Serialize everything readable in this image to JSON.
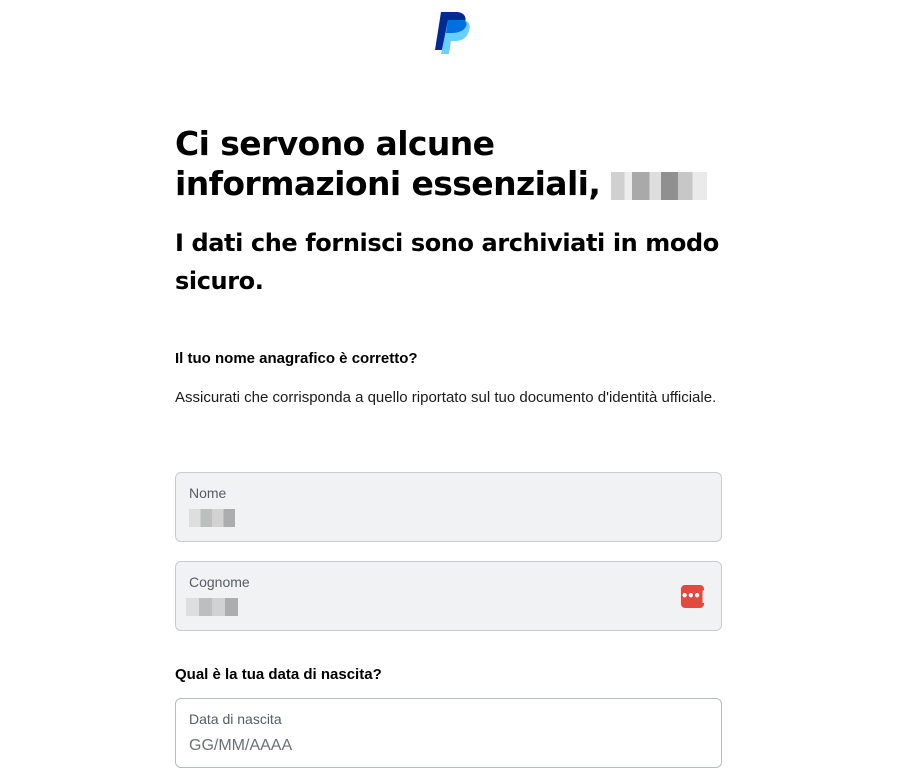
{
  "brand": {
    "logo_icon": "paypal-logo",
    "colors": {
      "dark_blue": "#002991",
      "light_blue": "#60cdff",
      "mid_blue": "#0070e0"
    }
  },
  "header": {
    "title": "Ci servono alcune informazioni essenziali,",
    "subtitle": "I dati che fornisci sono archiviati in modo sicuro."
  },
  "name_section": {
    "heading": "Il tuo nome anagrafico è corretto?",
    "description": "Assicurati che corrisponda a quello riportato sul tuo documento d'identità ufficiale."
  },
  "fields": {
    "first_name": {
      "label": "Nome"
    },
    "last_name": {
      "label": "Cognome",
      "icon": "password-manager-icon",
      "icon_glyph": "•••|",
      "icon_color": "#e04a3f"
    }
  },
  "dob_section": {
    "heading": "Qual è la tua data di nascita?",
    "field": {
      "label": "Data di nascita",
      "placeholder": "GG/MM/AAAA"
    }
  }
}
